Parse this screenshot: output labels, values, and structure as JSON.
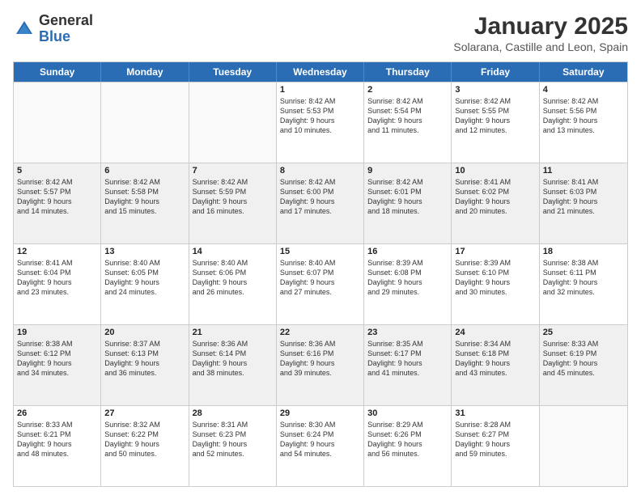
{
  "header": {
    "logo_general": "General",
    "logo_blue": "Blue",
    "month_title": "January 2025",
    "subtitle": "Solarana, Castille and Leon, Spain"
  },
  "days_of_week": [
    "Sunday",
    "Monday",
    "Tuesday",
    "Wednesday",
    "Thursday",
    "Friday",
    "Saturday"
  ],
  "rows": [
    [
      {
        "day": "",
        "empty": true
      },
      {
        "day": "",
        "empty": true
      },
      {
        "day": "",
        "empty": true
      },
      {
        "day": "1",
        "lines": [
          "Sunrise: 8:42 AM",
          "Sunset: 5:53 PM",
          "Daylight: 9 hours",
          "and 10 minutes."
        ]
      },
      {
        "day": "2",
        "lines": [
          "Sunrise: 8:42 AM",
          "Sunset: 5:54 PM",
          "Daylight: 9 hours",
          "and 11 minutes."
        ]
      },
      {
        "day": "3",
        "lines": [
          "Sunrise: 8:42 AM",
          "Sunset: 5:55 PM",
          "Daylight: 9 hours",
          "and 12 minutes."
        ]
      },
      {
        "day": "4",
        "lines": [
          "Sunrise: 8:42 AM",
          "Sunset: 5:56 PM",
          "Daylight: 9 hours",
          "and 13 minutes."
        ]
      }
    ],
    [
      {
        "day": "5",
        "lines": [
          "Sunrise: 8:42 AM",
          "Sunset: 5:57 PM",
          "Daylight: 9 hours",
          "and 14 minutes."
        ]
      },
      {
        "day": "6",
        "lines": [
          "Sunrise: 8:42 AM",
          "Sunset: 5:58 PM",
          "Daylight: 9 hours",
          "and 15 minutes."
        ]
      },
      {
        "day": "7",
        "lines": [
          "Sunrise: 8:42 AM",
          "Sunset: 5:59 PM",
          "Daylight: 9 hours",
          "and 16 minutes."
        ]
      },
      {
        "day": "8",
        "lines": [
          "Sunrise: 8:42 AM",
          "Sunset: 6:00 PM",
          "Daylight: 9 hours",
          "and 17 minutes."
        ]
      },
      {
        "day": "9",
        "lines": [
          "Sunrise: 8:42 AM",
          "Sunset: 6:01 PM",
          "Daylight: 9 hours",
          "and 18 minutes."
        ]
      },
      {
        "day": "10",
        "lines": [
          "Sunrise: 8:41 AM",
          "Sunset: 6:02 PM",
          "Daylight: 9 hours",
          "and 20 minutes."
        ]
      },
      {
        "day": "11",
        "lines": [
          "Sunrise: 8:41 AM",
          "Sunset: 6:03 PM",
          "Daylight: 9 hours",
          "and 21 minutes."
        ]
      }
    ],
    [
      {
        "day": "12",
        "lines": [
          "Sunrise: 8:41 AM",
          "Sunset: 6:04 PM",
          "Daylight: 9 hours",
          "and 23 minutes."
        ]
      },
      {
        "day": "13",
        "lines": [
          "Sunrise: 8:40 AM",
          "Sunset: 6:05 PM",
          "Daylight: 9 hours",
          "and 24 minutes."
        ]
      },
      {
        "day": "14",
        "lines": [
          "Sunrise: 8:40 AM",
          "Sunset: 6:06 PM",
          "Daylight: 9 hours",
          "and 26 minutes."
        ]
      },
      {
        "day": "15",
        "lines": [
          "Sunrise: 8:40 AM",
          "Sunset: 6:07 PM",
          "Daylight: 9 hours",
          "and 27 minutes."
        ]
      },
      {
        "day": "16",
        "lines": [
          "Sunrise: 8:39 AM",
          "Sunset: 6:08 PM",
          "Daylight: 9 hours",
          "and 29 minutes."
        ]
      },
      {
        "day": "17",
        "lines": [
          "Sunrise: 8:39 AM",
          "Sunset: 6:10 PM",
          "Daylight: 9 hours",
          "and 30 minutes."
        ]
      },
      {
        "day": "18",
        "lines": [
          "Sunrise: 8:38 AM",
          "Sunset: 6:11 PM",
          "Daylight: 9 hours",
          "and 32 minutes."
        ]
      }
    ],
    [
      {
        "day": "19",
        "lines": [
          "Sunrise: 8:38 AM",
          "Sunset: 6:12 PM",
          "Daylight: 9 hours",
          "and 34 minutes."
        ]
      },
      {
        "day": "20",
        "lines": [
          "Sunrise: 8:37 AM",
          "Sunset: 6:13 PM",
          "Daylight: 9 hours",
          "and 36 minutes."
        ]
      },
      {
        "day": "21",
        "lines": [
          "Sunrise: 8:36 AM",
          "Sunset: 6:14 PM",
          "Daylight: 9 hours",
          "and 38 minutes."
        ]
      },
      {
        "day": "22",
        "lines": [
          "Sunrise: 8:36 AM",
          "Sunset: 6:16 PM",
          "Daylight: 9 hours",
          "and 39 minutes."
        ]
      },
      {
        "day": "23",
        "lines": [
          "Sunrise: 8:35 AM",
          "Sunset: 6:17 PM",
          "Daylight: 9 hours",
          "and 41 minutes."
        ]
      },
      {
        "day": "24",
        "lines": [
          "Sunrise: 8:34 AM",
          "Sunset: 6:18 PM",
          "Daylight: 9 hours",
          "and 43 minutes."
        ]
      },
      {
        "day": "25",
        "lines": [
          "Sunrise: 8:33 AM",
          "Sunset: 6:19 PM",
          "Daylight: 9 hours",
          "and 45 minutes."
        ]
      }
    ],
    [
      {
        "day": "26",
        "lines": [
          "Sunrise: 8:33 AM",
          "Sunset: 6:21 PM",
          "Daylight: 9 hours",
          "and 48 minutes."
        ]
      },
      {
        "day": "27",
        "lines": [
          "Sunrise: 8:32 AM",
          "Sunset: 6:22 PM",
          "Daylight: 9 hours",
          "and 50 minutes."
        ]
      },
      {
        "day": "28",
        "lines": [
          "Sunrise: 8:31 AM",
          "Sunset: 6:23 PM",
          "Daylight: 9 hours",
          "and 52 minutes."
        ]
      },
      {
        "day": "29",
        "lines": [
          "Sunrise: 8:30 AM",
          "Sunset: 6:24 PM",
          "Daylight: 9 hours",
          "and 54 minutes."
        ]
      },
      {
        "day": "30",
        "lines": [
          "Sunrise: 8:29 AM",
          "Sunset: 6:26 PM",
          "Daylight: 9 hours",
          "and 56 minutes."
        ]
      },
      {
        "day": "31",
        "lines": [
          "Sunrise: 8:28 AM",
          "Sunset: 6:27 PM",
          "Daylight: 9 hours",
          "and 59 minutes."
        ]
      },
      {
        "day": "",
        "empty": true
      }
    ]
  ]
}
